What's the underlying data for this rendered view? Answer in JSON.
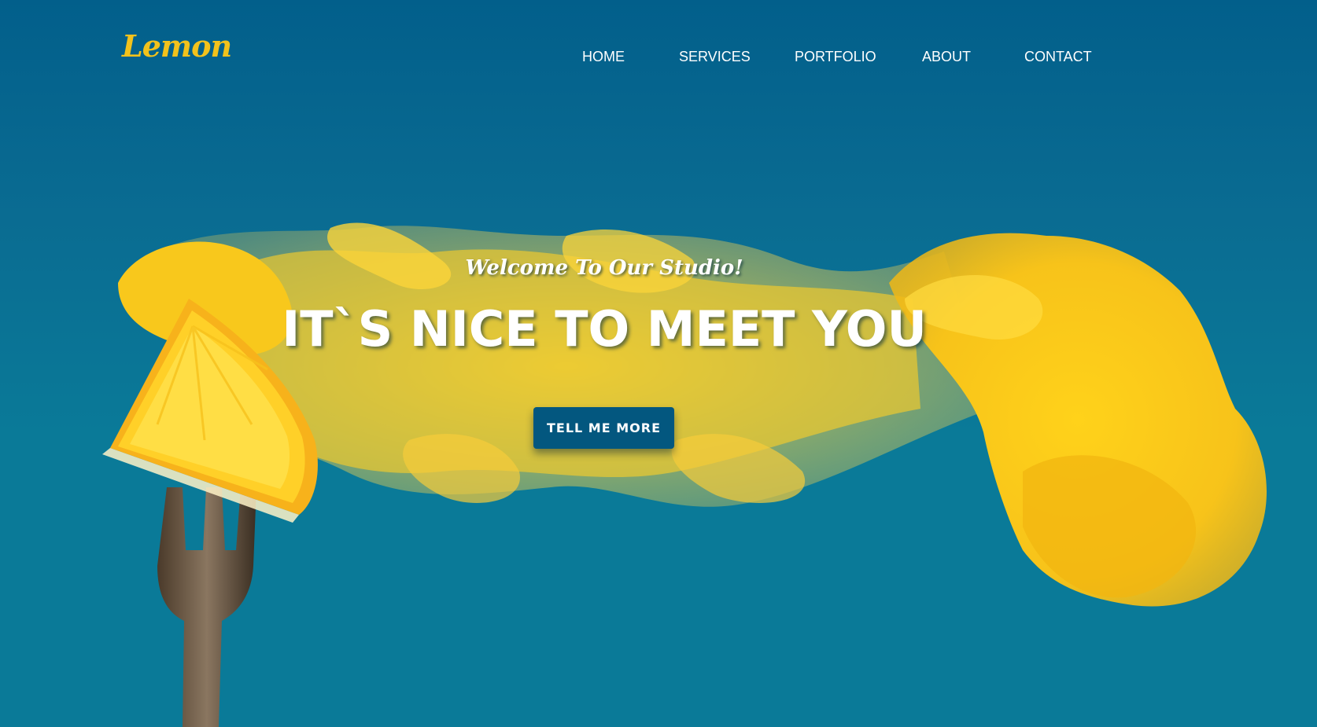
{
  "brand": {
    "logo_text": "Lemon",
    "color": "#f2c21c"
  },
  "nav": {
    "items": [
      {
        "label": "HOME"
      },
      {
        "label": "SERVICES"
      },
      {
        "label": "PORTFOLIO"
      },
      {
        "label": "ABOUT"
      },
      {
        "label": "CONTACT"
      }
    ]
  },
  "hero": {
    "welcome": "Welcome To Our Studio!",
    "headline": "IT`S NICE TO MEET YOU",
    "cta_label": "TELL ME MORE",
    "background_color": "#0a7a98",
    "button_color": "#03577f",
    "image_subject": "lemon-slice-on-fork-with-yellow-ink-cloud"
  }
}
